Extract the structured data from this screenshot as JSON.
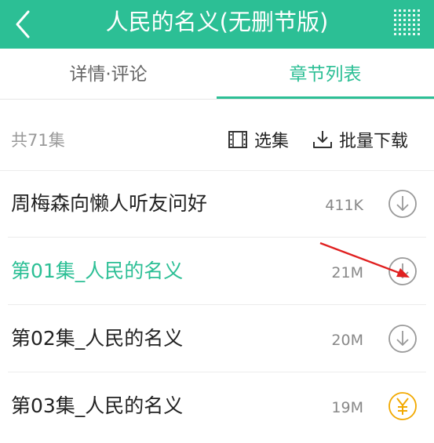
{
  "header": {
    "title": "人民的名义(无删节版)",
    "background_color": "#2cbf95",
    "back_icon": "chevron-left-icon",
    "menu_icon": "dot-grid-menu-icon"
  },
  "tabs": [
    {
      "label": "详情·评论",
      "active": false
    },
    {
      "label": "章节列表",
      "active": true
    }
  ],
  "toolbar": {
    "count_text": "共71集",
    "select_label": "选集",
    "select_icon": "film-strip-icon",
    "batch_download_label": "批量下载",
    "batch_download_icon": "download-tray-icon"
  },
  "episodes": [
    {
      "title": "周梅森向懒人听友问好",
      "size": "411K",
      "action_icon": "download-circle-icon",
      "active": false
    },
    {
      "title": "第01集_人民的名义",
      "size": "21M",
      "action_icon": "download-circle-icon",
      "active": true
    },
    {
      "title": "第02集_人民的名义",
      "size": "20M",
      "action_icon": "download-circle-icon",
      "active": false
    },
    {
      "title": "第03集_人民的名义",
      "size": "19M",
      "action_icon": "paid-yen-icon",
      "active": false
    }
  ],
  "colors": {
    "accent": "#2cbf95",
    "paid_icon": "#f2a900",
    "annotation_arrow": "#e02020"
  }
}
